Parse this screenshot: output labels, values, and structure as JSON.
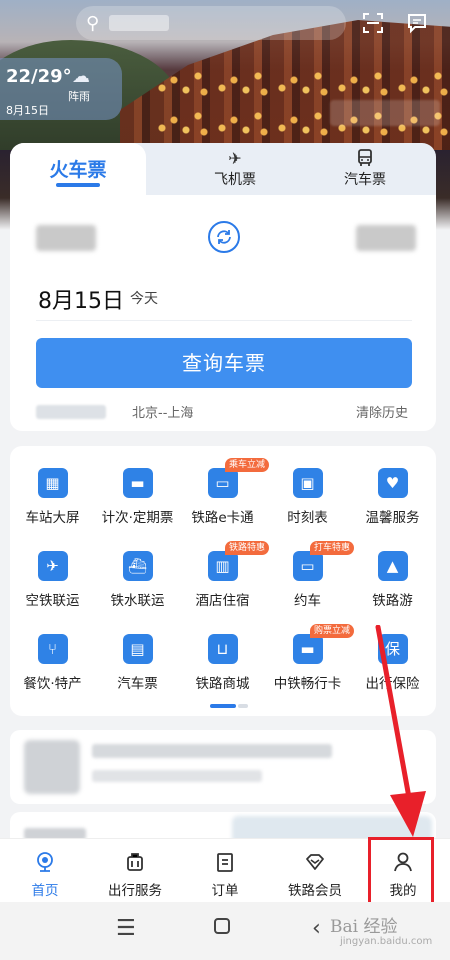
{
  "weather": {
    "temp": "22/29°",
    "condition": "阵雨",
    "date": "8月15日"
  },
  "tabs": [
    {
      "label": "火车票"
    },
    {
      "label": "飞机票"
    },
    {
      "label": "汽车票"
    }
  ],
  "booking": {
    "date": "8月15日",
    "date_sub": "今天",
    "query_button": "查询车票",
    "history_item": "北京--上海",
    "clear_history": "清除历史"
  },
  "services": [
    {
      "label": "车站大屏",
      "icon": "calendar-icon"
    },
    {
      "label": "计次·定期票",
      "icon": "ticket-card-icon"
    },
    {
      "label": "铁路e卡通",
      "icon": "rail-card-icon",
      "badge": "乘车立减"
    },
    {
      "label": "时刻表",
      "icon": "train-front-icon"
    },
    {
      "label": "温馨服务",
      "icon": "heart-icon"
    },
    {
      "label": "空铁联运",
      "icon": "plane-icon"
    },
    {
      "label": "铁水联运",
      "icon": "ship-icon"
    },
    {
      "label": "酒店住宿",
      "icon": "hotel-icon",
      "badge": "铁路特惠"
    },
    {
      "label": "约车",
      "icon": "car-icon",
      "badge": "打车特惠"
    },
    {
      "label": "铁路游",
      "icon": "mountain-icon"
    },
    {
      "label": "餐饮·特产",
      "icon": "dining-icon"
    },
    {
      "label": "汽车票",
      "icon": "bus-icon"
    },
    {
      "label": "铁路商城",
      "icon": "cart-icon"
    },
    {
      "label": "中铁畅行卡",
      "icon": "pass-card-icon",
      "badge": "购票立减"
    },
    {
      "label": "出行保险",
      "icon": "shield-icon"
    }
  ],
  "bottom_nav": [
    {
      "label": "首页",
      "icon": "home-icon",
      "active": true
    },
    {
      "label": "出行服务",
      "icon": "luggage-icon"
    },
    {
      "label": "订单",
      "icon": "order-icon"
    },
    {
      "label": "铁路会员",
      "icon": "member-icon"
    },
    {
      "label": "我的",
      "icon": "profile-icon"
    }
  ],
  "watermark": {
    "text": "Bai 经验",
    "sub": "jingyan.baidu.com"
  },
  "colors": {
    "accent": "#2b7ae8",
    "button": "#3f8ff0",
    "highlight": "#e8202a",
    "badge": "#f36b3d"
  }
}
